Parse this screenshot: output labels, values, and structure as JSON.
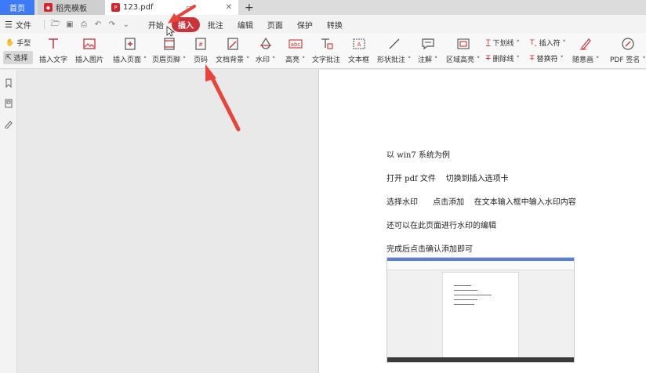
{
  "tabs": {
    "home": "首页",
    "template": "稻壳模板",
    "file": "123.pdf",
    "add": "+"
  },
  "menu": {
    "file": "文件",
    "items": [
      "开始",
      "插入",
      "批注",
      "编辑",
      "页面",
      "保护",
      "转换"
    ]
  },
  "ribbon": {
    "hand": "手型",
    "select": "选择",
    "tools": [
      {
        "label": "插入文字"
      },
      {
        "label": "插入图片"
      },
      {
        "label": "插入页面 ˅"
      },
      {
        "label": "页眉页脚 ˅"
      },
      {
        "label": "页码"
      },
      {
        "label": "文档背景 ˅"
      },
      {
        "label": "水印 ˅"
      },
      {
        "label": "高亮 ˅"
      },
      {
        "label": "文字批注"
      },
      {
        "label": "文本框"
      },
      {
        "label": "形状批注 ˅"
      },
      {
        "label": "注解 ˅"
      },
      {
        "label": "区域高亮 ˅"
      },
      {
        "label": "随意画 ˅"
      },
      {
        "label": "PDF 签名 ˅"
      }
    ],
    "small": {
      "underline": "下划线 ˅",
      "strikethrough": "删除线 ˅",
      "insert_char": "插入符 ˅",
      "replace_char": "替换符 ˅"
    }
  },
  "document": {
    "lines": [
      "以 win7 系统为例",
      "打开 pdf 文件    切换到插入选项卡",
      "选择水印      点击添加    在文本输入框中输入水印内容",
      "还可以在此页面进行水印的编辑",
      "完成后点击确认添加即可"
    ]
  },
  "colors": {
    "accent": "#3d7af5",
    "active_menu": "#c8343a",
    "arrow": "#e8443a"
  }
}
